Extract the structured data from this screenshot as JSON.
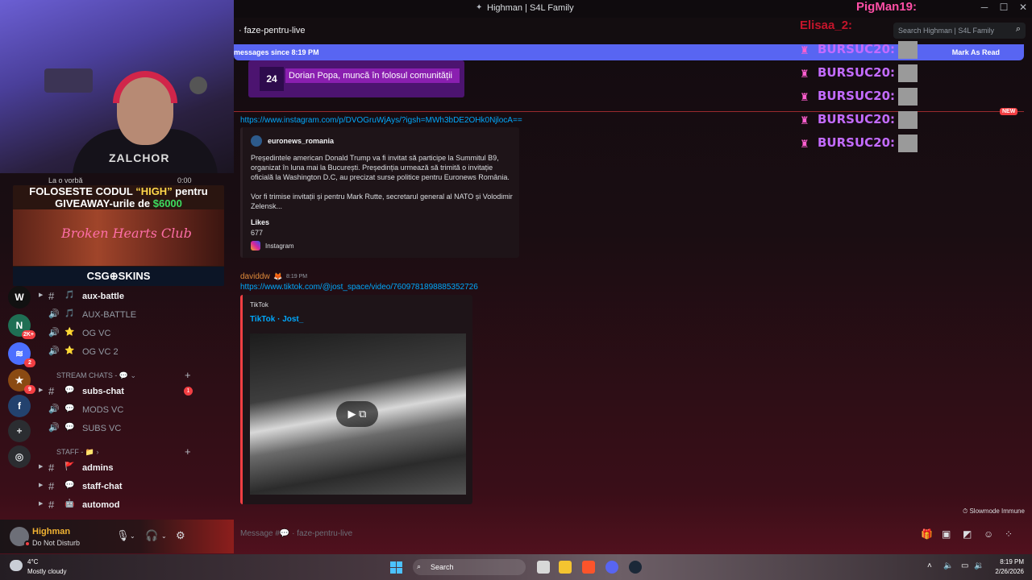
{
  "window": {
    "title": "Highman | S4L Family",
    "minimize": "─",
    "maximize": "☐",
    "close": "✕"
  },
  "stream_overlay": {
    "shirt_text": "ZALCHOR",
    "now_playing": "La o vorbă",
    "now_playing_time": "0:00",
    "promo_line1_a": "FOLOSESTE CODUL ",
    "promo_line1_code": "“HIGH”",
    "promo_line1_b": " pentru",
    "promo_line2_a": "GIVEAWAY-urile de ",
    "promo_line2_amount": "$6000",
    "promo_club": "Broken Hearts Club",
    "promo_brand": "CSG⊕SKINS",
    "alerts": [
      {
        "text": "BURSUC20:"
      },
      {
        "text": "BURSUC20:"
      },
      {
        "text": "BURSUC20:"
      },
      {
        "text": "BURSUC20:"
      },
      {
        "text": "BURSUC20:"
      }
    ],
    "pigman": "PigMan19:",
    "elisaa": "Elisaa_2:"
  },
  "server_rail": [
    {
      "label": "W",
      "badge": ""
    },
    {
      "label": "N",
      "badge": "2K+"
    },
    {
      "label": "≋",
      "badge": "2"
    },
    {
      "label": "★",
      "badge": "9"
    },
    {
      "label": "f",
      "badge": ""
    },
    {
      "label": "+",
      "badge": ""
    },
    {
      "label": "◎",
      "badge": ""
    }
  ],
  "channels": {
    "list": [
      {
        "emoji": "🎵",
        "name": "aux-battle",
        "bold": true,
        "type": "#"
      },
      {
        "emoji": "🎵",
        "name": "AUX-BATTLE",
        "bold": false,
        "type": "🔊"
      },
      {
        "emoji": "⭐",
        "name": "OG VC",
        "bold": false,
        "type": "🔊"
      },
      {
        "emoji": "⭐",
        "name": "OG VC 2",
        "bold": false,
        "type": "🔊"
      }
    ],
    "category_stream": "STREAM CHATS - 💬",
    "stream": [
      {
        "emoji": "💬",
        "name": "subs-chat",
        "bold": true,
        "type": "#",
        "mention": "1"
      },
      {
        "emoji": "💬",
        "name": "MODS VC",
        "bold": false,
        "type": "🔊"
      },
      {
        "emoji": "💬",
        "name": "SUBS VC",
        "bold": false,
        "type": "🔊"
      }
    ],
    "category_staff": "STAFF - 📁",
    "staff": [
      {
        "emoji": "🚩",
        "name": "admins",
        "bold": true,
        "type": "#"
      },
      {
        "emoji": "💬",
        "name": "staff-chat",
        "bold": true,
        "type": "#"
      },
      {
        "emoji": "🤖",
        "name": "automod",
        "bold": true,
        "type": "#"
      }
    ]
  },
  "user": {
    "name": "Highman",
    "status": "Do Not Disturb"
  },
  "header": {
    "channel": "faze-pentru-live",
    "search_placeholder": "Search Highman | S4L Family"
  },
  "new_bar": {
    "text": "messages since 8:19 PM",
    "action": "Mark As Read"
  },
  "messages": {
    "top_embed_logo": "24",
    "top_embed_headline": "Dorian Popa, muncă în folosul comunității",
    "new_tag": "NEW",
    "ig_link": "https://www.instagram.com/p/DVOGruWjAys/?igsh=MWh3bDE2OHk0NjlocA==",
    "ig_author": "euronews_romania",
    "ig_desc_1": "Președintele american Donald Trump va fi invitat să participe la Summitul B9, organizat în luna mai la București. Președinția urmează să trimită o invitație oficială la Washington D.C, au precizat surse politice pentru Euronews România.",
    "ig_desc_2": "Vor fi trimise invitații și pentru Mark Rutte, secretarul general al NATO și Volodimir Zelensk...",
    "ig_likes_label": "Likes",
    "ig_likes": "677",
    "ig_footer": "Instagram",
    "author": "daviddw",
    "author_emoji": "🦊",
    "time": "8:19 PM",
    "tt_link": "https://www.tiktok.com/@jost_space/video/7609781898885352726",
    "tt_provider": "TikTok",
    "tt_title": "TikTok · Jost_",
    "slowmode": "Slowmode Immune"
  },
  "composer": {
    "placeholder": "Message #💬 · faze-pentru-live"
  },
  "taskbar": {
    "temp": "4°C",
    "weather": "Mostly cloudy",
    "search": "Search",
    "time": "8:19 PM",
    "date": "2/26/2026"
  }
}
